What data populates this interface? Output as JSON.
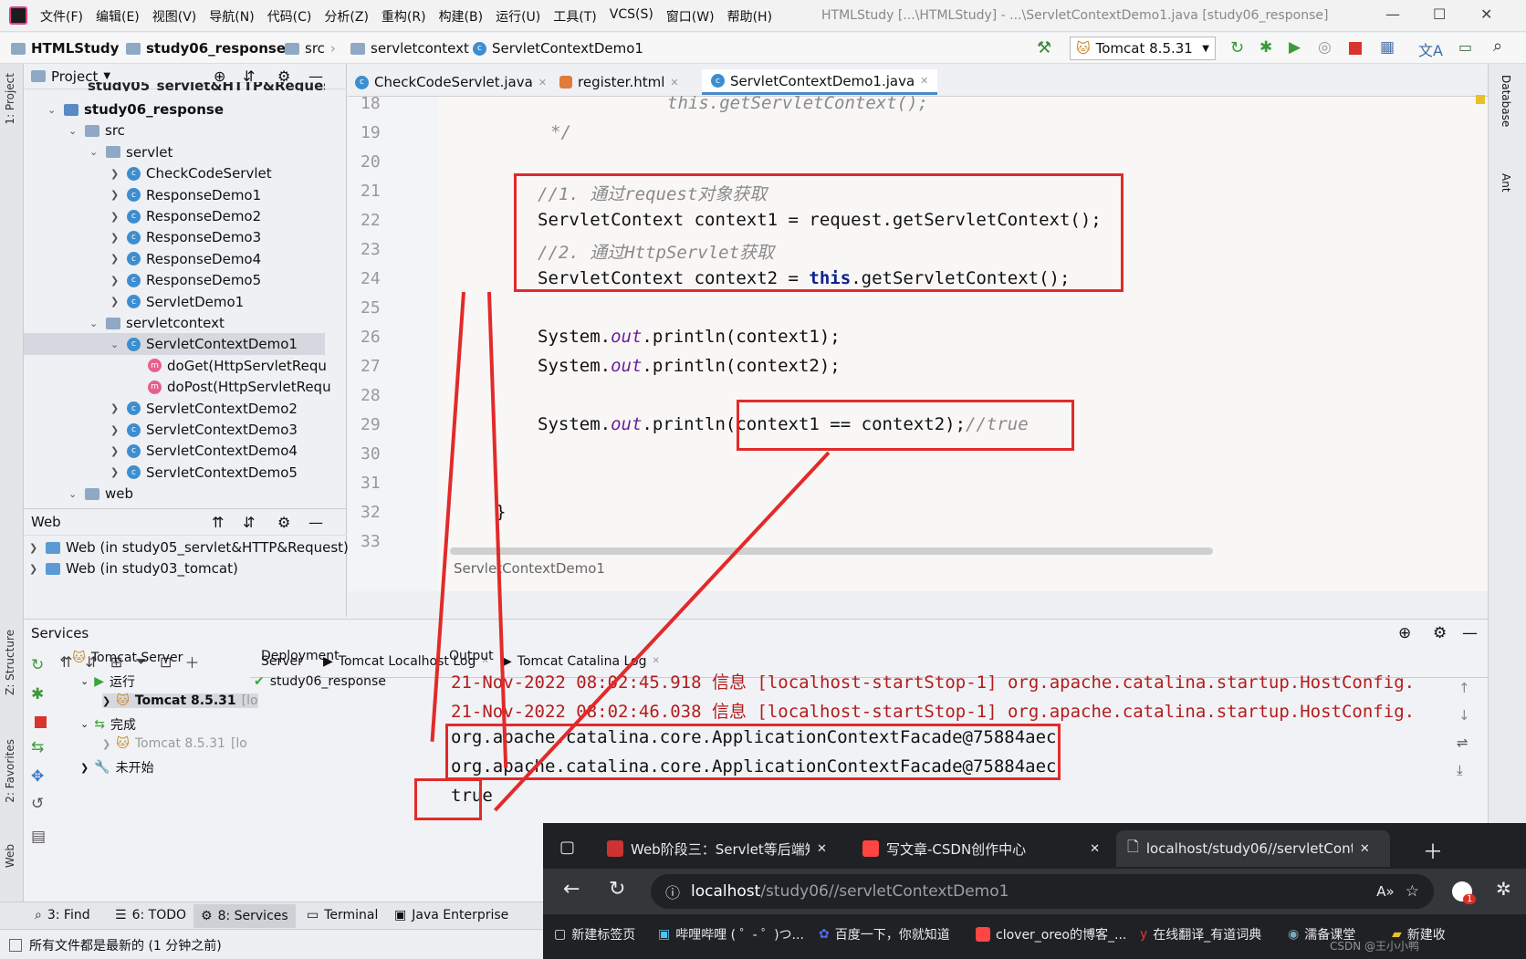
{
  "titlebar": {
    "app_icon": "intellij-icon",
    "menu": [
      "文件(F)",
      "编辑(E)",
      "视图(V)",
      "导航(N)",
      "代码(C)",
      "分析(Z)",
      "重构(R)",
      "构建(B)",
      "运行(U)",
      "工具(T)",
      "VCS(S)",
      "窗口(W)",
      "帮助(H)"
    ],
    "title": "HTMLStudy [...\\HTMLStudy] - ...\\ServletContextDemo1.java [study06_response]"
  },
  "navbar": {
    "crumbs": [
      "HTMLStudy",
      "study06_response",
      "src",
      "servletcontext",
      "ServletContextDemo1"
    ],
    "run_config": "Tomcat 8.5.31"
  },
  "project": {
    "header": "Project",
    "partial_top": "study05_servlet&HTTP&Request",
    "items": [
      {
        "label": "study06_response",
        "kind": "module",
        "indent": 0,
        "open": true
      },
      {
        "label": "src",
        "kind": "folder",
        "indent": 1,
        "open": true
      },
      {
        "label": "servlet",
        "kind": "folder",
        "indent": 2,
        "open": true
      },
      {
        "label": "CheckCodeServlet",
        "kind": "class",
        "indent": 3
      },
      {
        "label": "ResponseDemo1",
        "kind": "class",
        "indent": 3
      },
      {
        "label": "ResponseDemo2",
        "kind": "class",
        "indent": 3
      },
      {
        "label": "ResponseDemo3",
        "kind": "class",
        "indent": 3
      },
      {
        "label": "ResponseDemo4",
        "kind": "class",
        "indent": 3
      },
      {
        "label": "ResponseDemo5",
        "kind": "class",
        "indent": 3
      },
      {
        "label": "ServletDemo1",
        "kind": "class",
        "indent": 3
      },
      {
        "label": "servletcontext",
        "kind": "folder",
        "indent": 2,
        "open": true
      },
      {
        "label": "ServletContextDemo1",
        "kind": "class",
        "indent": 3,
        "open": true,
        "selected": true
      },
      {
        "label": "doGet(HttpServletRequ",
        "kind": "method",
        "indent": 4
      },
      {
        "label": "doPost(HttpServletRequ",
        "kind": "method",
        "indent": 4
      },
      {
        "label": "ServletContextDemo2",
        "kind": "class",
        "indent": 3
      },
      {
        "label": "ServletContextDemo3",
        "kind": "class",
        "indent": 3
      },
      {
        "label": "ServletContextDemo4",
        "kind": "class",
        "indent": 3
      },
      {
        "label": "ServletContextDemo5",
        "kind": "class",
        "indent": 3
      },
      {
        "label": "web",
        "kind": "folder",
        "indent": 1,
        "open": true
      }
    ],
    "web_header": "Web",
    "web_items": [
      "Web (in study05_servlet&HTTP&Request)",
      "Web (in study03_tomcat)"
    ]
  },
  "left_strip": {
    "project_tab": "1: Project",
    "structure_tab": "Z: Structure",
    "favorites_tab": "2: Favorites",
    "web_tab": "Web"
  },
  "right_strip": {
    "database": "Database",
    "ant": "Ant"
  },
  "editor": {
    "tabs": [
      {
        "label": "CheckCodeServlet.java",
        "icon": "class-icon"
      },
      {
        "label": "register.html",
        "icon": "html-icon"
      },
      {
        "label": "ServletContextDemo1.java",
        "icon": "class-icon",
        "active": true
      }
    ],
    "line_numbers": [
      "18",
      "19",
      "20",
      "21",
      "22",
      "23",
      "24",
      "25",
      "26",
      "27",
      "28",
      "29",
      "30",
      "31",
      "32",
      "33"
    ],
    "lines": {
      "l18": "this.getServletContext();",
      "l19": "*/",
      "l21": "//1. 通过request对象获取",
      "l22": "ServletContext context1 = request.getServletContext();",
      "l23": "//2. 通过HttpServlet获取",
      "l24a": "ServletContext context2 = ",
      "l24b": "this",
      "l24c": ".getServletContext();",
      "l26a": "System.",
      "l26b": "out",
      "l26c": ".println(context1);",
      "l27a": "System.",
      "l27b": "out",
      "l27c": ".println(context2);",
      "l29a": "System.",
      "l29b": "out",
      "l29c": ".println(context1 == context2);",
      "l29d": "//true",
      "l32": "}"
    },
    "breadcrumb": "ServletContextDemo1"
  },
  "services": {
    "title": "Services",
    "tabs": [
      "Server",
      "Tomcat Localhost Log",
      "Tomcat Catalina Log"
    ],
    "tree": [
      {
        "label": "Tomcat Server",
        "indent": 0
      },
      {
        "label": "运行",
        "indent": 1
      },
      {
        "label": "Tomcat 8.5.31",
        "indent": 2,
        "suffix": "[lo"
      },
      {
        "label": "完成",
        "indent": 1
      },
      {
        "label": "Tomcat 8.5.31",
        "indent": 2,
        "suffix": "[lo"
      },
      {
        "label": "未开始",
        "indent": 1
      }
    ],
    "deployment_header": "Deployment",
    "deployment_item": "study06_response",
    "output_header": "Output",
    "output": [
      "21-Nov-2022 08:02:45.918 信息 [localhost-startStop-1] org.apache.catalina.startup.HostConfig.",
      "21-Nov-2022 08:02:46.038 信息 [localhost-startStop-1] org.apache.catalina.startup.HostConfig.",
      "org.apache.catalina.core.ApplicationContextFacade@75884aec",
      "org.apache.catalina.core.ApplicationContextFacade@75884aec",
      "true"
    ]
  },
  "bottombar": {
    "tabs": [
      "3: Find",
      "6: TODO",
      "8: Services",
      "Terminal",
      "Java Enterprise"
    ]
  },
  "statusbar": {
    "message": "所有文件都是最新的 (1 分钟之前)"
  },
  "browser": {
    "tabs": [
      {
        "label": "Web阶段三：Servlet等后端知识",
        "icon": "csdn-icon"
      },
      {
        "label": "写文章-CSDN创作中心",
        "icon": "csdn-icon"
      },
      {
        "label": "localhost/study06//servletConte",
        "icon": "page-icon",
        "active": true
      }
    ],
    "url_host": "localhost",
    "url_path": "/study06//servletContextDemo1",
    "bookmarks": [
      "新建标签页",
      "哔哩哔哩 ( ゜- ゜)つ...",
      "百度一下，你就知道",
      "clover_oreo的博客_...",
      "在线翻译_有道词典",
      "濡备课堂",
      "新建收"
    ],
    "notif_badge": "1",
    "watermark": "CSDN @王小小鸭"
  },
  "colors": {
    "highlight_red": "#e22a2a",
    "keyword": "#0b2291",
    "comment": "#8a8a8a",
    "output_red": "#b41c1c"
  }
}
